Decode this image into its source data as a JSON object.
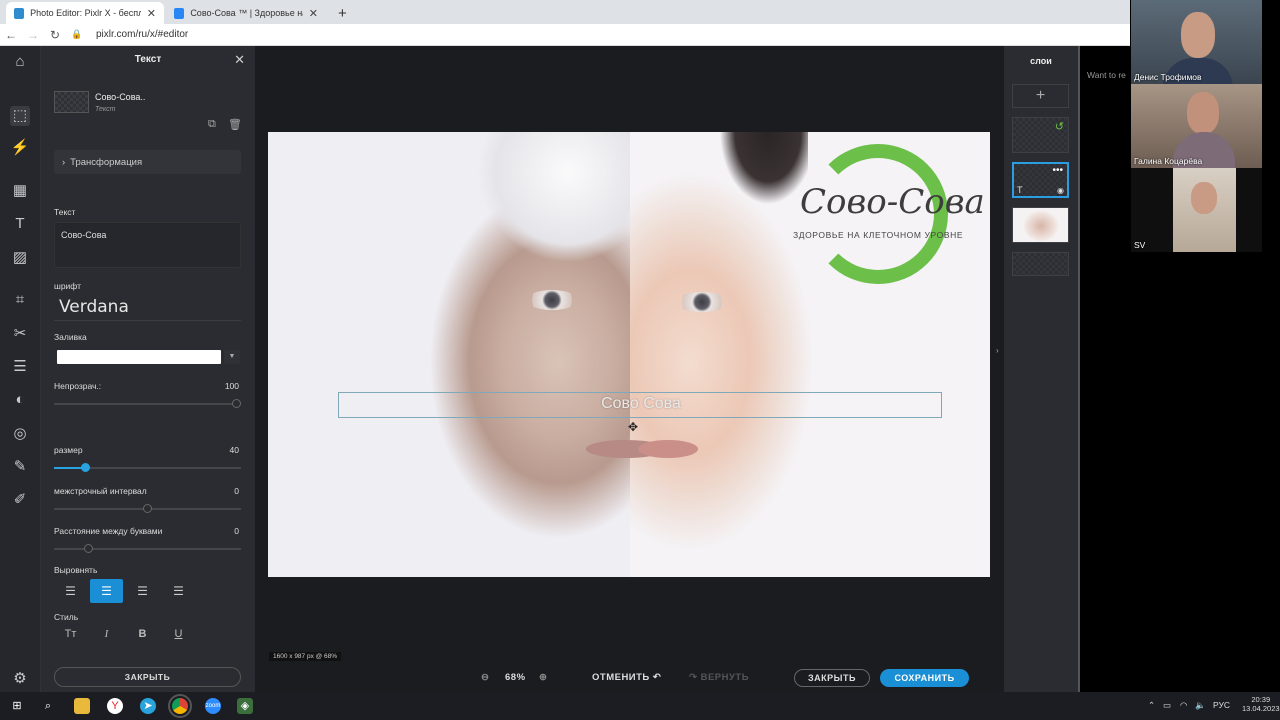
{
  "browser": {
    "tabs": [
      {
        "title": "Photo Editor: Pixlr X - бесплатн",
        "icon_color": "#2e8ccf"
      },
      {
        "title": "Сово-Сова ™ | Здоровье на кле",
        "icon_color": "#2787f5"
      }
    ],
    "url": "pixlr.com/ru/x/#editor",
    "new_tab": "+"
  },
  "left_panel": {
    "title": "Текст",
    "layer_name": "Сово-Сова..",
    "layer_type": "Текст",
    "transform_label": "Трансформация",
    "text_label": "Текст",
    "text_value": "Сово-Сова",
    "font_label": "шрифт",
    "font_value": "Verdana",
    "fill_label": "Заливка",
    "fill_color": "#ffffff",
    "opacity_label": "Непрозрач.:",
    "opacity_value": "100",
    "size_label": "размер",
    "size_value": "40",
    "line_label": "межстрочный интервал",
    "line_value": "0",
    "letter_label": "Расстояние между буквами",
    "letter_value": "0",
    "align_label": "Выровнять",
    "style_label": "Стиль",
    "close_label": "ЗАКРЫТЬ"
  },
  "canvas": {
    "logo_title": "Сово-Сова",
    "logo_subtitle": "ЗДОРОВЬЕ НА КЛЕТОЧНОМ УРОВНЕ",
    "selected_text": "Сово Сова",
    "dimensions": "1600 x 987 px @ 68%"
  },
  "bottom_bar": {
    "zoom": "68%",
    "undo": "ОТМЕНИТЬ",
    "redo": "ВЕРНУТЬ",
    "close": "ЗАКРЫТЬ",
    "save": "СОХРАНИТЬ"
  },
  "right_panel": {
    "title": "слои"
  },
  "meeting": {
    "want_text": "Want to re",
    "participants": [
      "Денис Трофимов",
      "Галина Коцарёва",
      "SV"
    ]
  },
  "taskbar": {
    "lang": "РУС",
    "time": "20:39",
    "date": "13.04.2023"
  },
  "colors": {
    "accent": "#1a8fd6",
    "logo_green": "#6cc04a"
  }
}
